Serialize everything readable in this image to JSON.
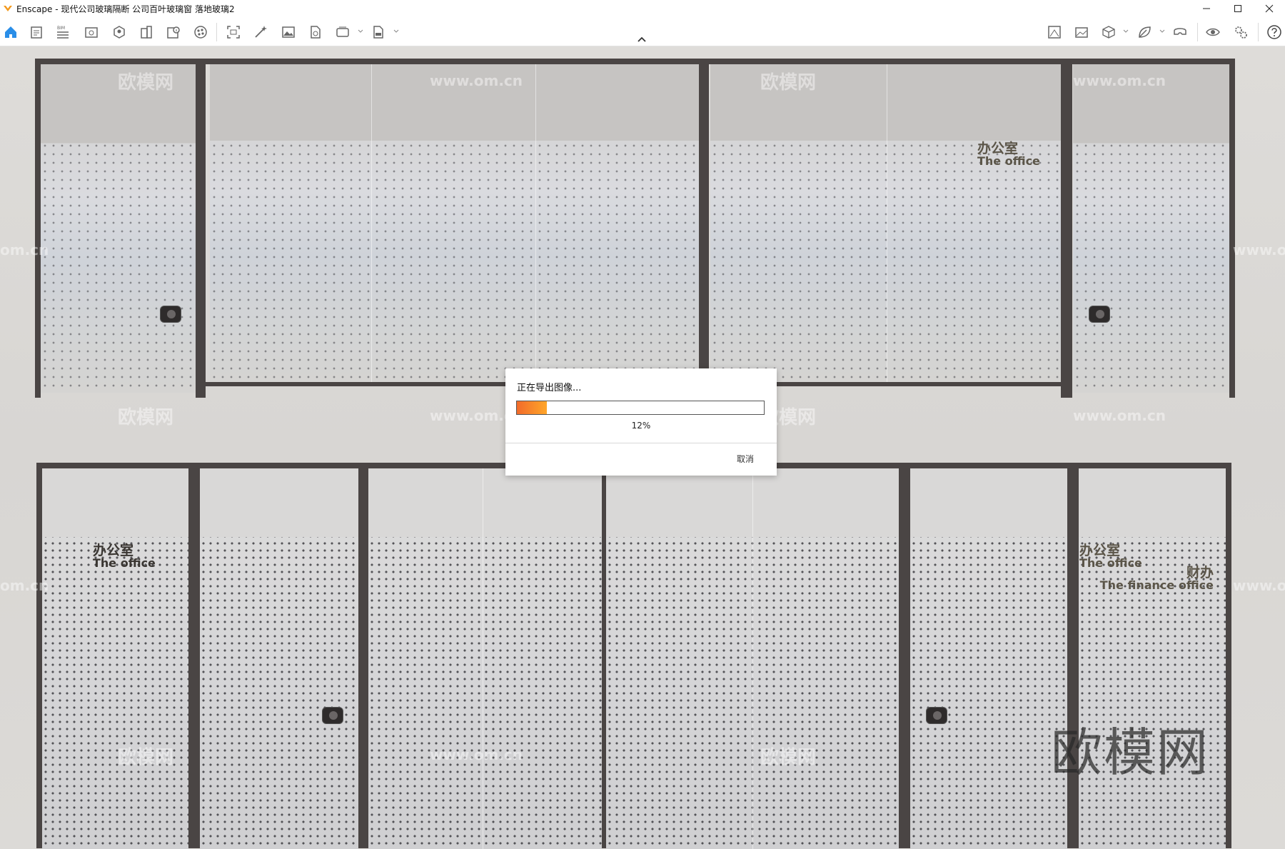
{
  "window": {
    "title": "Enscape - 现代公司玻璃隔断 公司百叶玻璃窗 落地玻璃2",
    "controls": [
      "minimize-icon",
      "maximize-icon",
      "close-icon"
    ]
  },
  "toolbar": {
    "left_icons": [
      "home-icon",
      "notes-icon",
      "bim-icon",
      "view-icon",
      "asset-library-icon",
      "building-icon",
      "info-panel-icon",
      "material-ball-icon",
      "capture-icon",
      "magic-wand-icon",
      "image-icon",
      "file-export-icon",
      "batch-render-icon",
      "exe-export-icon"
    ],
    "bim_label": "BIM",
    "right_icons": [
      "minimap-icon",
      "panorama-icon",
      "box-view-icon",
      "leaf-icon",
      "vr-headset-icon",
      "eye-icon",
      "settings-icon",
      "help-icon"
    ],
    "collapse_icon": "chevron-up-icon",
    "accent": "#2a8ee8"
  },
  "scene": {
    "signs": {
      "top_right": {
        "cn": "办公室",
        "en": "The office"
      },
      "bottom_left": {
        "cn": "办公室",
        "en": "The office"
      },
      "bottom_right_a": {
        "cn": "办公室",
        "en": "The office"
      },
      "bottom_right_b": {
        "cn": "财办",
        "en": "The finance office"
      }
    },
    "watermark_cn": "欧模网",
    "watermark_url": "www.om.cn",
    "watermark_big": "欧模网",
    "watermark_edge_left": "om.cn",
    "watermark_edge_right": "www.om"
  },
  "dialog": {
    "message": "正在导出图像...",
    "progress_percent": 12,
    "progress_label": "12%",
    "cancel_label": "取消",
    "bar_colors": [
      "#f26b2a",
      "#ffa629"
    ]
  }
}
